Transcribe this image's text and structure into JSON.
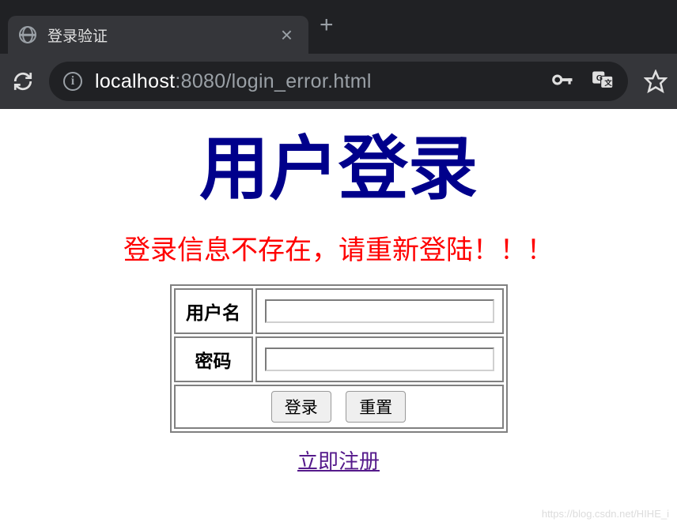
{
  "browser": {
    "tab_title": "登录验证",
    "url_host": "localhost",
    "url_port": ":8080",
    "url_path": "/login_error.html"
  },
  "page": {
    "title": "用户登录",
    "error_message": "登录信息不存在，请重新登陆！！！",
    "fields": {
      "username_label": "用户名",
      "password_label": "密码",
      "username_value": "",
      "password_value": ""
    },
    "buttons": {
      "submit": "登录",
      "reset": "重置"
    },
    "register_link": "立即注册"
  },
  "watermark": "https://blog.csdn.net/HIHE_i"
}
